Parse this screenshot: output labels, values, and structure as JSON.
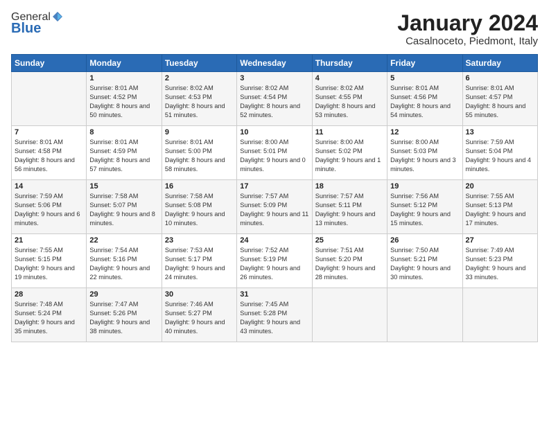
{
  "header": {
    "logo_general": "General",
    "logo_blue": "Blue",
    "month_title": "January 2024",
    "location": "Casalnoceto, Piedmont, Italy"
  },
  "days_of_week": [
    "Sunday",
    "Monday",
    "Tuesday",
    "Wednesday",
    "Thursday",
    "Friday",
    "Saturday"
  ],
  "weeks": [
    [
      {
        "day": "",
        "sunrise": "",
        "sunset": "",
        "daylight": ""
      },
      {
        "day": "1",
        "sunrise": "Sunrise: 8:01 AM",
        "sunset": "Sunset: 4:52 PM",
        "daylight": "Daylight: 8 hours and 50 minutes."
      },
      {
        "day": "2",
        "sunrise": "Sunrise: 8:02 AM",
        "sunset": "Sunset: 4:53 PM",
        "daylight": "Daylight: 8 hours and 51 minutes."
      },
      {
        "day": "3",
        "sunrise": "Sunrise: 8:02 AM",
        "sunset": "Sunset: 4:54 PM",
        "daylight": "Daylight: 8 hours and 52 minutes."
      },
      {
        "day": "4",
        "sunrise": "Sunrise: 8:02 AM",
        "sunset": "Sunset: 4:55 PM",
        "daylight": "Daylight: 8 hours and 53 minutes."
      },
      {
        "day": "5",
        "sunrise": "Sunrise: 8:01 AM",
        "sunset": "Sunset: 4:56 PM",
        "daylight": "Daylight: 8 hours and 54 minutes."
      },
      {
        "day": "6",
        "sunrise": "Sunrise: 8:01 AM",
        "sunset": "Sunset: 4:57 PM",
        "daylight": "Daylight: 8 hours and 55 minutes."
      }
    ],
    [
      {
        "day": "7",
        "sunrise": "Sunrise: 8:01 AM",
        "sunset": "Sunset: 4:58 PM",
        "daylight": "Daylight: 8 hours and 56 minutes."
      },
      {
        "day": "8",
        "sunrise": "Sunrise: 8:01 AM",
        "sunset": "Sunset: 4:59 PM",
        "daylight": "Daylight: 8 hours and 57 minutes."
      },
      {
        "day": "9",
        "sunrise": "Sunrise: 8:01 AM",
        "sunset": "Sunset: 5:00 PM",
        "daylight": "Daylight: 8 hours and 58 minutes."
      },
      {
        "day": "10",
        "sunrise": "Sunrise: 8:00 AM",
        "sunset": "Sunset: 5:01 PM",
        "daylight": "Daylight: 9 hours and 0 minutes."
      },
      {
        "day": "11",
        "sunrise": "Sunrise: 8:00 AM",
        "sunset": "Sunset: 5:02 PM",
        "daylight": "Daylight: 9 hours and 1 minute."
      },
      {
        "day": "12",
        "sunrise": "Sunrise: 8:00 AM",
        "sunset": "Sunset: 5:03 PM",
        "daylight": "Daylight: 9 hours and 3 minutes."
      },
      {
        "day": "13",
        "sunrise": "Sunrise: 7:59 AM",
        "sunset": "Sunset: 5:04 PM",
        "daylight": "Daylight: 9 hours and 4 minutes."
      }
    ],
    [
      {
        "day": "14",
        "sunrise": "Sunrise: 7:59 AM",
        "sunset": "Sunset: 5:06 PM",
        "daylight": "Daylight: 9 hours and 6 minutes."
      },
      {
        "day": "15",
        "sunrise": "Sunrise: 7:58 AM",
        "sunset": "Sunset: 5:07 PM",
        "daylight": "Daylight: 9 hours and 8 minutes."
      },
      {
        "day": "16",
        "sunrise": "Sunrise: 7:58 AM",
        "sunset": "Sunset: 5:08 PM",
        "daylight": "Daylight: 9 hours and 10 minutes."
      },
      {
        "day": "17",
        "sunrise": "Sunrise: 7:57 AM",
        "sunset": "Sunset: 5:09 PM",
        "daylight": "Daylight: 9 hours and 11 minutes."
      },
      {
        "day": "18",
        "sunrise": "Sunrise: 7:57 AM",
        "sunset": "Sunset: 5:11 PM",
        "daylight": "Daylight: 9 hours and 13 minutes."
      },
      {
        "day": "19",
        "sunrise": "Sunrise: 7:56 AM",
        "sunset": "Sunset: 5:12 PM",
        "daylight": "Daylight: 9 hours and 15 minutes."
      },
      {
        "day": "20",
        "sunrise": "Sunrise: 7:55 AM",
        "sunset": "Sunset: 5:13 PM",
        "daylight": "Daylight: 9 hours and 17 minutes."
      }
    ],
    [
      {
        "day": "21",
        "sunrise": "Sunrise: 7:55 AM",
        "sunset": "Sunset: 5:15 PM",
        "daylight": "Daylight: 9 hours and 19 minutes."
      },
      {
        "day": "22",
        "sunrise": "Sunrise: 7:54 AM",
        "sunset": "Sunset: 5:16 PM",
        "daylight": "Daylight: 9 hours and 22 minutes."
      },
      {
        "day": "23",
        "sunrise": "Sunrise: 7:53 AM",
        "sunset": "Sunset: 5:17 PM",
        "daylight": "Daylight: 9 hours and 24 minutes."
      },
      {
        "day": "24",
        "sunrise": "Sunrise: 7:52 AM",
        "sunset": "Sunset: 5:19 PM",
        "daylight": "Daylight: 9 hours and 26 minutes."
      },
      {
        "day": "25",
        "sunrise": "Sunrise: 7:51 AM",
        "sunset": "Sunset: 5:20 PM",
        "daylight": "Daylight: 9 hours and 28 minutes."
      },
      {
        "day": "26",
        "sunrise": "Sunrise: 7:50 AM",
        "sunset": "Sunset: 5:21 PM",
        "daylight": "Daylight: 9 hours and 30 minutes."
      },
      {
        "day": "27",
        "sunrise": "Sunrise: 7:49 AM",
        "sunset": "Sunset: 5:23 PM",
        "daylight": "Daylight: 9 hours and 33 minutes."
      }
    ],
    [
      {
        "day": "28",
        "sunrise": "Sunrise: 7:48 AM",
        "sunset": "Sunset: 5:24 PM",
        "daylight": "Daylight: 9 hours and 35 minutes."
      },
      {
        "day": "29",
        "sunrise": "Sunrise: 7:47 AM",
        "sunset": "Sunset: 5:26 PM",
        "daylight": "Daylight: 9 hours and 38 minutes."
      },
      {
        "day": "30",
        "sunrise": "Sunrise: 7:46 AM",
        "sunset": "Sunset: 5:27 PM",
        "daylight": "Daylight: 9 hours and 40 minutes."
      },
      {
        "day": "31",
        "sunrise": "Sunrise: 7:45 AM",
        "sunset": "Sunset: 5:28 PM",
        "daylight": "Daylight: 9 hours and 43 minutes."
      },
      {
        "day": "",
        "sunrise": "",
        "sunset": "",
        "daylight": ""
      },
      {
        "day": "",
        "sunrise": "",
        "sunset": "",
        "daylight": ""
      },
      {
        "day": "",
        "sunrise": "",
        "sunset": "",
        "daylight": ""
      }
    ]
  ]
}
